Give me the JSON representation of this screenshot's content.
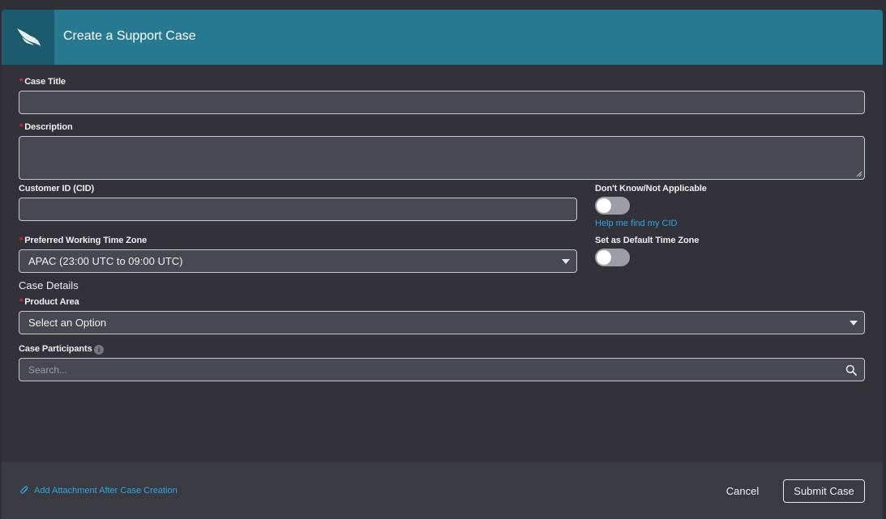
{
  "header": {
    "logo_icon": "falcon-logo-icon",
    "title": "Create a Support Case"
  },
  "form": {
    "case_title": {
      "label": "Case Title",
      "required": true,
      "value": ""
    },
    "description": {
      "label": "Description",
      "required": true,
      "value": ""
    },
    "customer_id": {
      "label": "Customer ID (CID)",
      "value": ""
    },
    "dont_know": {
      "label": "Don't Know/Not Applicable",
      "toggle_on": false
    },
    "help_link": "Help me find my CID",
    "time_zone": {
      "label": "Preferred Working Time Zone",
      "required": true,
      "selected": "APAC (23:00 UTC to 09:00 UTC)"
    },
    "default_tz": {
      "label": "Set as Default Time Zone",
      "toggle_on": false
    },
    "case_details_title": "Case Details",
    "product_area": {
      "label": "Product Area",
      "required": true,
      "selected": "Select an Option"
    },
    "participants": {
      "label": "Case Participants",
      "info_icon": "info-icon",
      "placeholder": "Search..."
    }
  },
  "footer": {
    "attachment_link": "Add Attachment After Case Creation",
    "attachment_icon": "paperclip-icon",
    "cancel_label": "Cancel",
    "submit_label": "Submit Case"
  },
  "colors": {
    "header_bg": "#267991",
    "logo_bg": "#1c5b6e",
    "link": "#2ea7e8",
    "required": "#e0283a",
    "panel_bg": "#323238"
  }
}
